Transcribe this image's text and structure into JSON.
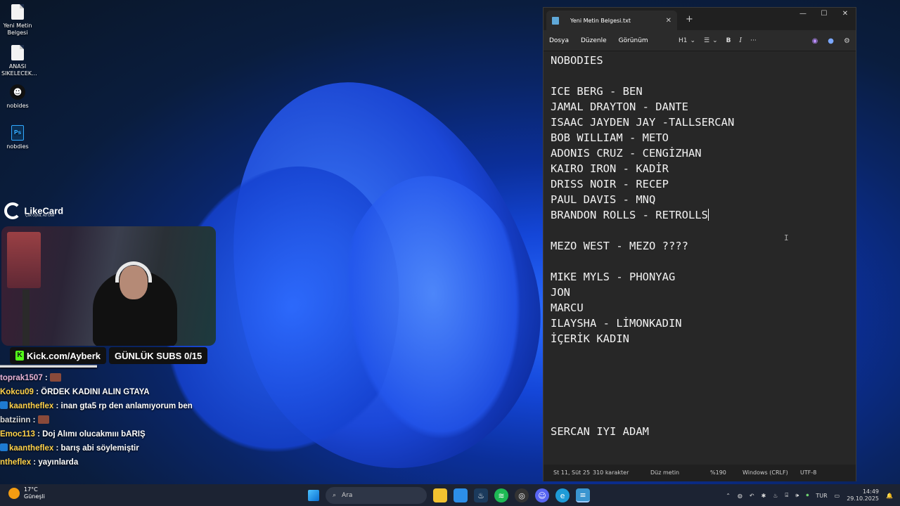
{
  "desktop": {
    "icons": [
      {
        "label": "Yeni Metin Belgesi",
        "icon": "text-file-icon"
      },
      {
        "label": "ANASI SIKELECEK...",
        "icon": "text-file-icon"
      },
      {
        "label": "nobides",
        "icon": "face-app-icon"
      },
      {
        "label": "nobdies",
        "icon": "photoshop-file-icon"
      }
    ]
  },
  "overlay": {
    "likecard": {
      "title": "LikeCard",
      "subtitle": "Çok Oyna, Az Öde"
    },
    "kick_url": "Kick.com/Ayberk",
    "subs": "GÜNLÜK SUBS 0/15"
  },
  "chat": [
    {
      "user": "toprak1507",
      "sep": " : ",
      "msg": "",
      "user_color": "#e8b4d8",
      "badge": false,
      "emote": true
    },
    {
      "user": "Kokcu09",
      "sep": " : ",
      "msg": "ÖRDEK KADINI ALIN GTAYA",
      "user_color": "#ffd24a",
      "badge": false,
      "emote": false
    },
    {
      "user": "kaantheflex",
      "sep": " : ",
      "msg": "inan gta5 rp den anlamıyorum ben",
      "user_color": "#ffd24a",
      "badge": true,
      "emote": false
    },
    {
      "user": "batziinn",
      "sep": " : ",
      "msg": "",
      "user_color": "#d9d9d9",
      "badge": false,
      "emote": true
    },
    {
      "user": "Emoc113",
      "sep": " : ",
      "msg": "Doj Alımı olucakmııı bARIŞ",
      "user_color": "#ffd24a",
      "badge": false,
      "emote": false
    },
    {
      "user": "kaantheflex",
      "sep": " : ",
      "msg": "barış abi söylemiştir",
      "user_color": "#ffd24a",
      "badge": true,
      "emote": false
    },
    {
      "user": "ntheflex",
      "sep": " : ",
      "msg": "yayınlarda",
      "user_color": "#ffd24a",
      "badge": false,
      "emote": false
    }
  ],
  "notepad": {
    "tab_title": "Yeni Metin Belgesi.txt",
    "window_controls": {
      "minimize": "—",
      "maximize": "☐",
      "close": "✕"
    },
    "menu": [
      "Dosya",
      "Düzenle",
      "Görünüm"
    ],
    "toolbar": {
      "heading": "H1",
      "list": "☰",
      "bold": "B",
      "italic": "I",
      "more": "···"
    },
    "lines": [
      "NOBODIES",
      "",
      "ICE BERG - BEN",
      "JAMAL DRAYTON - DANTE",
      "ISAAC JAYDEN JAY -TALLSERCAN",
      "BOB WILLIAM - METO",
      "ADONIS CRUZ - CENGİZHAN",
      "KAIRO IRON - KADİR",
      "DRISS NOIR - RECEP",
      "PAUL DAVIS - MNQ",
      "BRANDON ROLLS - RETROLLS",
      "",
      "MEZO WEST - MEZO ????",
      "",
      "MIKE MYLS - PHONYAG",
      "JON",
      "MARCU",
      "ILAYSHA - LİMONKADIN",
      "İÇERİK KADIN",
      "",
      "",
      "",
      "",
      "",
      "SERCAN IYI ADAM"
    ],
    "caret_line": 10,
    "status": {
      "position": "St 11, Süt 25",
      "chars": "310 karakter",
      "format": "Düz metin",
      "zoom": "%190",
      "line_ending": "Windows (CRLF)",
      "encoding": "UTF-8"
    }
  },
  "taskbar": {
    "weather": {
      "temp": "17°C",
      "desc": "Güneşli"
    },
    "search_placeholder": "Ara",
    "lang": "TUR",
    "time": "14:49",
    "date": "29.10.2025"
  }
}
